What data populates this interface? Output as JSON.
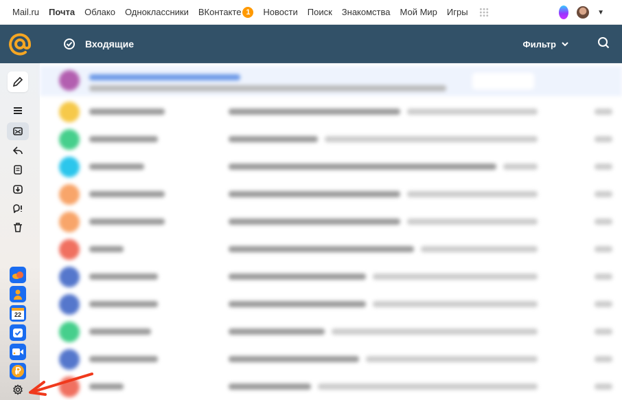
{
  "topnav": {
    "items": [
      {
        "label": "Mail.ru"
      },
      {
        "label": "Почта",
        "active": true
      },
      {
        "label": "Облако"
      },
      {
        "label": "Одноклассники"
      },
      {
        "label": "ВКонтакте",
        "badge": "1"
      },
      {
        "label": "Новости"
      },
      {
        "label": "Поиск"
      },
      {
        "label": "Знакомства"
      },
      {
        "label": "Мой Мир"
      },
      {
        "label": "Игры"
      }
    ]
  },
  "header": {
    "folder": "Входящие",
    "filter": "Фильтр",
    "accent": "#325168",
    "logo_color": "#f5a623"
  },
  "sidebar": {
    "icons": [
      "menu-icon",
      "inbox-icon",
      "sent-icon",
      "drafts-icon",
      "archive-icon",
      "spam-icon",
      "trash-icon"
    ],
    "apps": [
      {
        "name": "cloud"
      },
      {
        "name": "contacts"
      },
      {
        "name": "calendar",
        "label": "22"
      },
      {
        "name": "tasks"
      },
      {
        "name": "video-calls"
      },
      {
        "name": "money"
      }
    ]
  },
  "emails": [
    {
      "color": "#b35fb0"
    },
    {
      "color": "#f6c94a"
    },
    {
      "color": "#46cf8c"
    },
    {
      "color": "#2bc6ec"
    },
    {
      "color": "#f8a56a"
    },
    {
      "color": "#f8a56a"
    },
    {
      "color": "#f07060"
    },
    {
      "color": "#5577cc"
    },
    {
      "color": "#5577cc"
    },
    {
      "color": "#46cf8c"
    },
    {
      "color": "#5577cc"
    },
    {
      "color": "#f07060"
    }
  ]
}
